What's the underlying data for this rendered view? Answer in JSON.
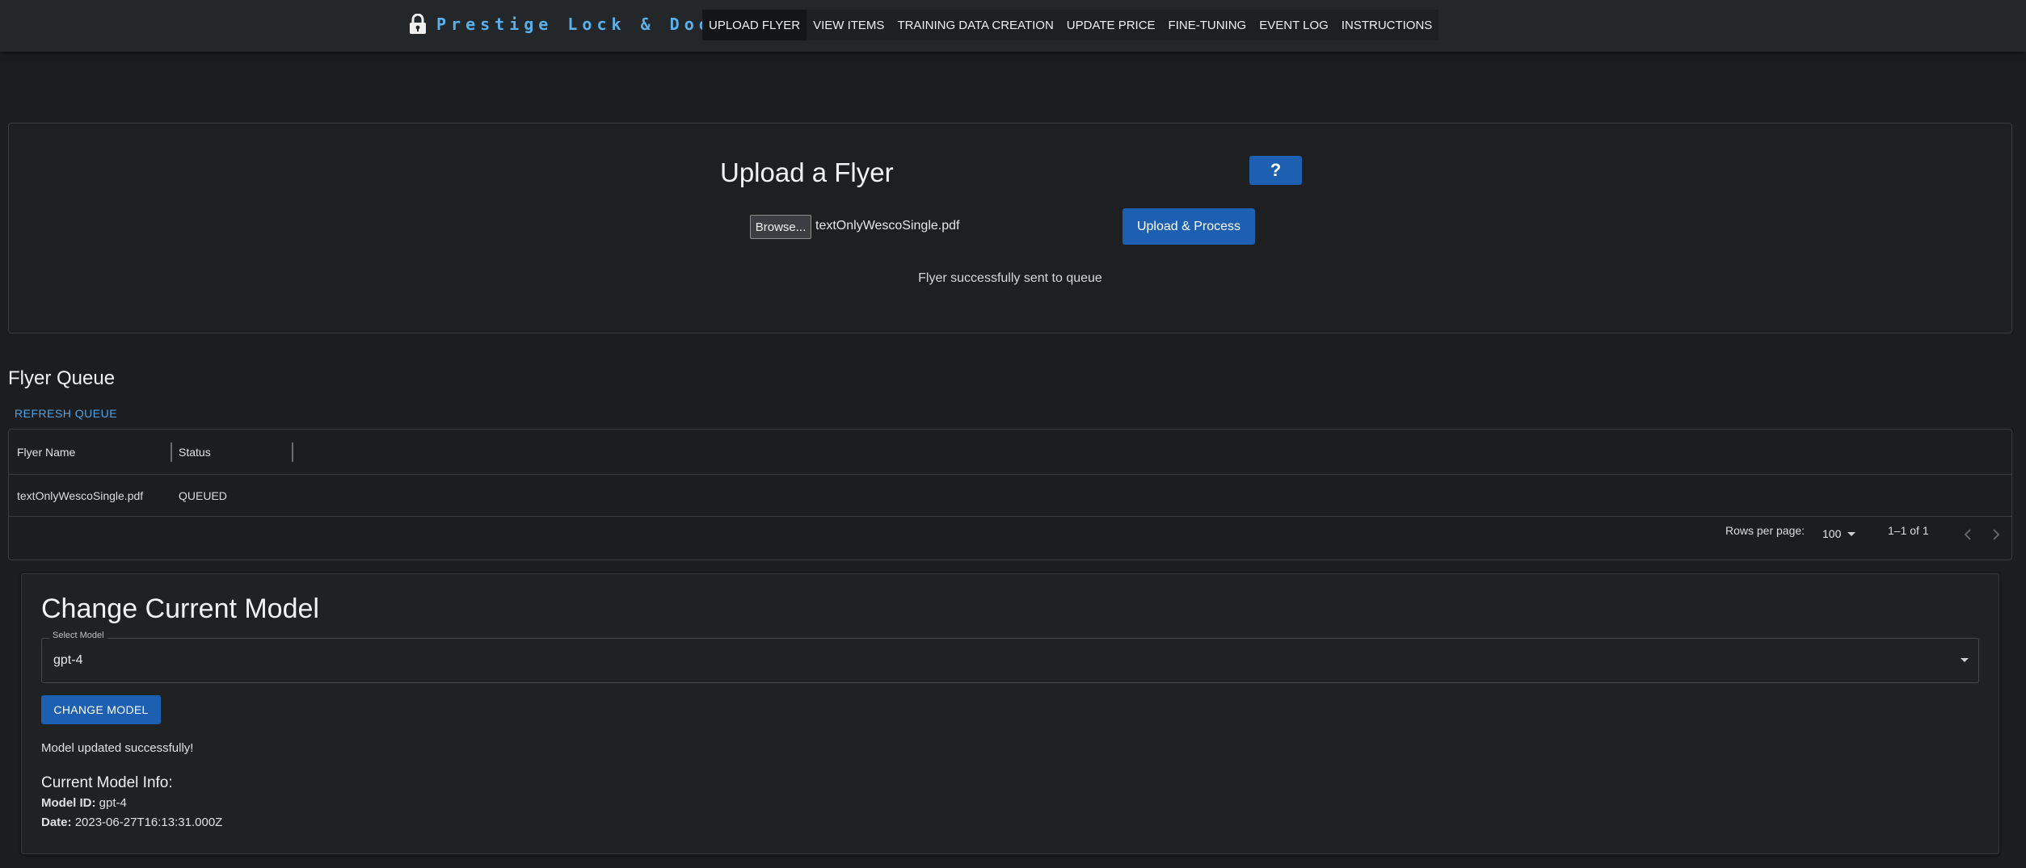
{
  "header": {
    "brand": "Prestige Lock & Door",
    "nav": [
      "UPLOAD FLYER",
      "VIEW ITEMS",
      "TRAINING DATA CREATION",
      "UPDATE PRICE",
      "FINE-TUNING",
      "EVENT LOG",
      "INSTRUCTIONS"
    ],
    "active_nav": "UPLOAD FLYER"
  },
  "upload": {
    "title": "Upload a Flyer",
    "help_label": "?",
    "browse_label": "Browse...",
    "file_name": "textOnlyWescoSingle.pdf",
    "upload_label": "Upload & Process",
    "message": "Flyer successfully sent to queue"
  },
  "queue": {
    "title": "Flyer Queue",
    "refresh_label": "REFRESH QUEUE",
    "columns": [
      "Flyer Name",
      "Status"
    ],
    "rows": [
      {
        "name": "textOnlyWescoSingle.pdf",
        "status": "QUEUED"
      }
    ],
    "rows_per_page_label": "Rows per page:",
    "rows_per_page": "100",
    "page_info": "1–1 of 1"
  },
  "model": {
    "title": "Change Current Model",
    "select_label": "Select Model",
    "selected": "gpt-4",
    "change_label": "CHANGE MODEL",
    "message": "Model updated successfully!",
    "info_title": "Current Model Info:",
    "id_label": "Model ID:",
    "id_value": "gpt-4",
    "date_label": "Date:",
    "date_value": "2023-06-27T16:13:31.000Z"
  },
  "colors": {
    "accent": "#1d5fb0",
    "brand_text": "#5ab0ea",
    "link": "#4fa3e6",
    "background": "#1b1d1f"
  },
  "icons": [
    "lock-icon",
    "chevron-down-icon",
    "chevron-left-icon",
    "chevron-right-icon"
  ]
}
